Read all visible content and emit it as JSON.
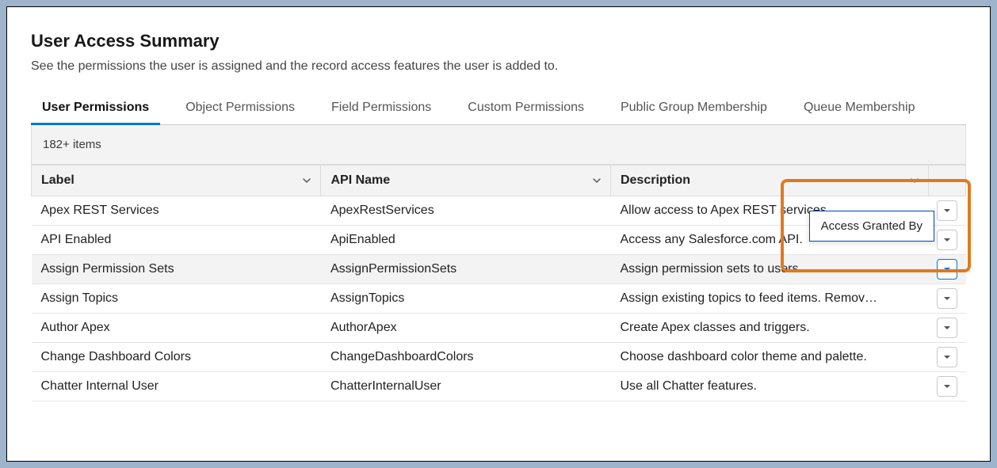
{
  "header": {
    "title": "User Access Summary",
    "subtitle": "See the permissions the user is assigned and the record access features the user is added to."
  },
  "tabs": [
    {
      "label": "User Permissions",
      "active": true
    },
    {
      "label": "Object Permissions",
      "active": false
    },
    {
      "label": "Field Permissions",
      "active": false
    },
    {
      "label": "Custom Permissions",
      "active": false
    },
    {
      "label": "Public Group Membership",
      "active": false
    },
    {
      "label": "Queue Membership",
      "active": false
    }
  ],
  "table": {
    "items_count": "182+ items",
    "columns": {
      "label": "Label",
      "api_name": "API Name",
      "description": "Description"
    },
    "rows": [
      {
        "label": "Apex REST Services",
        "api_name": "ApexRestServices",
        "description": "Allow access to Apex REST services"
      },
      {
        "label": "API Enabled",
        "api_name": "ApiEnabled",
        "description": "Access any Salesforce.com API."
      },
      {
        "label": "Assign Permission Sets",
        "api_name": "AssignPermissionSets",
        "description": "Assign permission sets to users."
      },
      {
        "label": "Assign Topics",
        "api_name": "AssignTopics",
        "description": "Assign existing topics to feed items. Remov…"
      },
      {
        "label": "Author Apex",
        "api_name": "AuthorApex",
        "description": "Create Apex classes and triggers."
      },
      {
        "label": "Change Dashboard Colors",
        "api_name": "ChangeDashboardColors",
        "description": "Choose dashboard color theme and palette."
      },
      {
        "label": "Chatter Internal User",
        "api_name": "ChatterInternalUser",
        "description": "Use all Chatter features."
      }
    ]
  },
  "popover": {
    "access_granted_by": "Access Granted By"
  }
}
